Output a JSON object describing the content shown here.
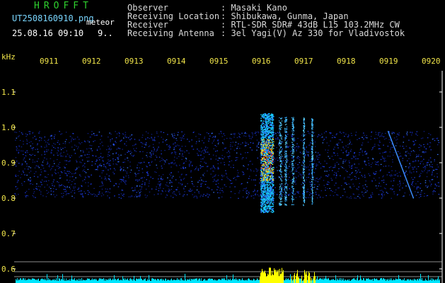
{
  "header": {
    "brand": "HROFFT",
    "filename": "UT2508160910.png",
    "meteor_label": "meteor",
    "datetime": "25.08.16 09:10",
    "count": "9..",
    "info": [
      {
        "key": "Observer",
        "value": ": Masaki Kano"
      },
      {
        "key": "Receiving Location",
        "value": ": Shibukawa, Gunma, Japan"
      },
      {
        "key": "Receiver",
        "value": ": RTL-SDR SDR# 43dB L15 103.2MHz CW"
      },
      {
        "key": "Receiving Antenna",
        "value": ": 3el Yagi(V) Az 330 for Vladivostok"
      }
    ]
  },
  "axes": {
    "unit": "kHz",
    "time_ticks": [
      "0911",
      "0912",
      "0913",
      "0914",
      "0915",
      "0916",
      "0917",
      "0918",
      "0919",
      "0920"
    ],
    "freq_ticks": [
      "1.1",
      "1.0",
      "0.9",
      "0.8",
      "0.7",
      "0.6"
    ]
  },
  "colors": {
    "background": "#000000",
    "band_noise": "#1b2fd0",
    "signal_hot": "#ff2a1a",
    "signal_warm": "#ffe81a",
    "signal_cool": "#18c8ff",
    "amplitude_cyan": "#00e5ff",
    "amplitude_yellow": "#ffff00",
    "tick_yellow": "#f2e64a"
  }
}
